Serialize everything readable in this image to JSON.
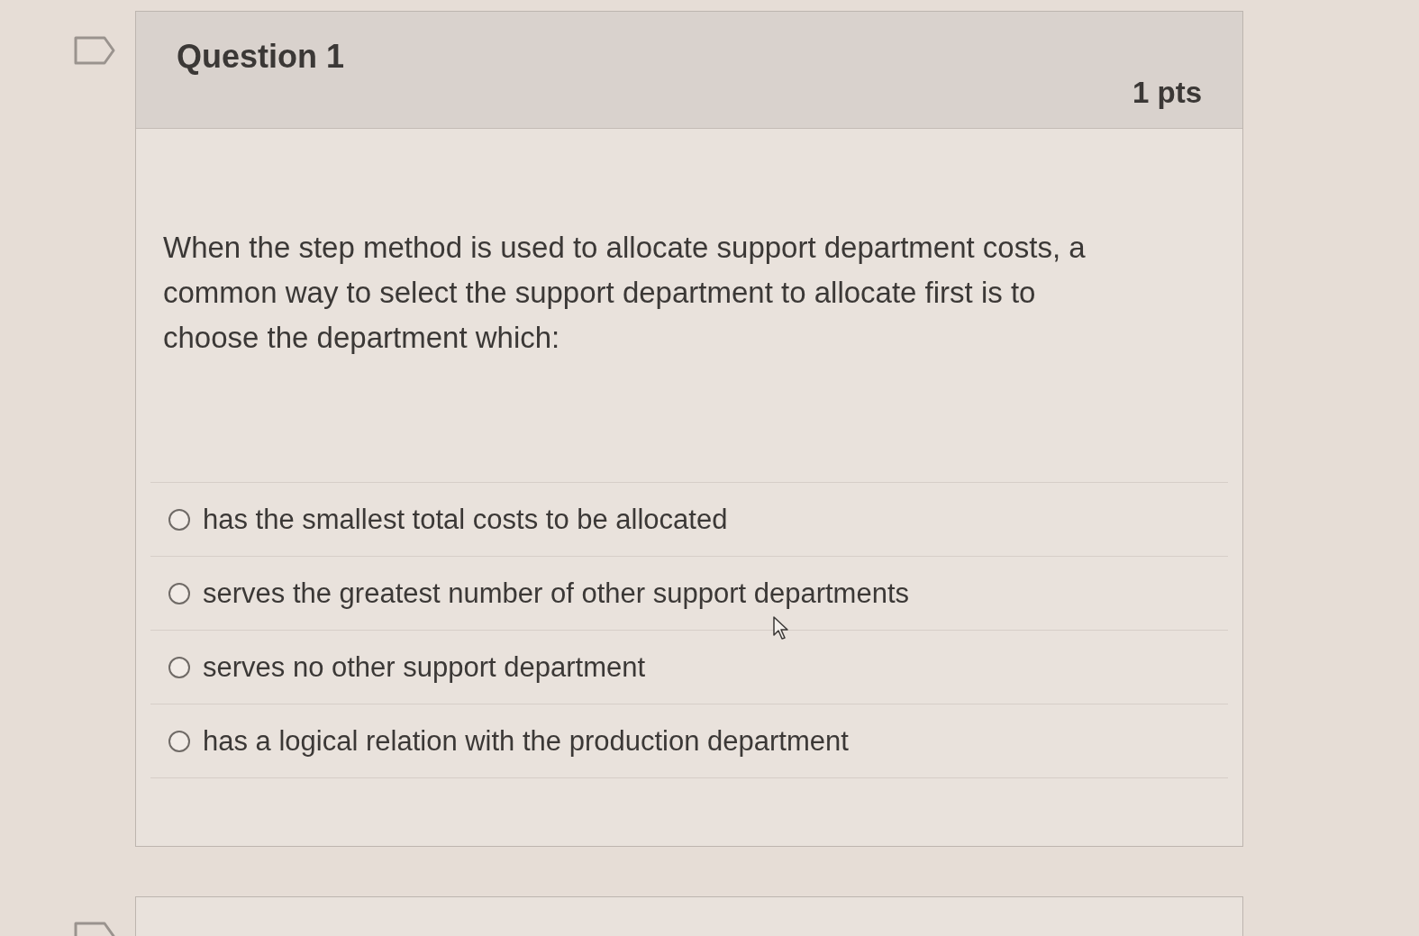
{
  "question": {
    "title": "Question 1",
    "points": "1 pts",
    "flagged": false,
    "text": "When the step method is used to allocate support department costs, a common way to select the support department to allocate first is to choose the department which:",
    "answers": [
      {
        "text": "has the smallest total costs to be allocated",
        "selected": false
      },
      {
        "text": "serves the greatest number of other support departments",
        "selected": false
      },
      {
        "text": "serves no other support department",
        "selected": false
      },
      {
        "text": "has a logical relation with the production department",
        "selected": false
      }
    ]
  }
}
